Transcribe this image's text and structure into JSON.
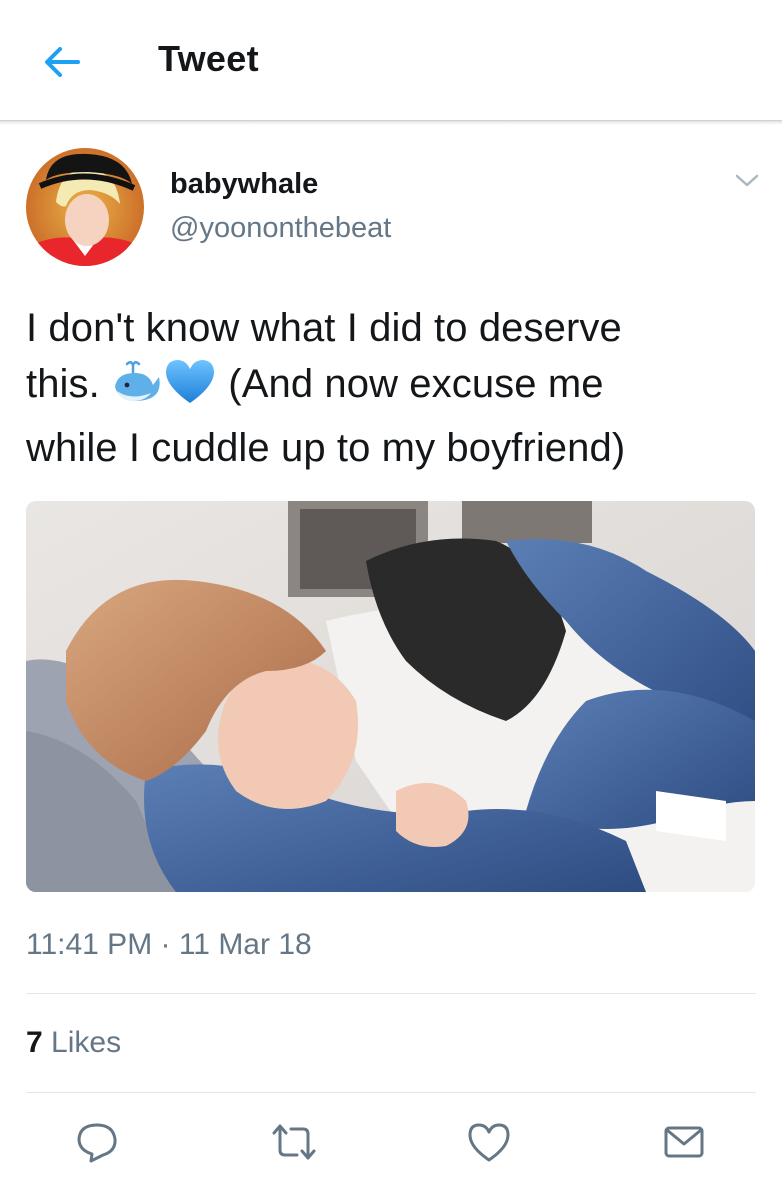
{
  "header": {
    "title": "Tweet",
    "back_icon": "arrow-left-icon",
    "accent_color": "#1da1f2"
  },
  "tweet": {
    "author": {
      "display_name": "babywhale",
      "handle": "@yoononthebeat"
    },
    "text_line1": "I don't know what I did to deserve",
    "text_line2_start": "this.",
    "text_line2_end": " (And now excuse me",
    "text_line3": "while I cuddle up to my boyfriend)",
    "emojis": [
      "spouting-whale-emoji",
      "blue-heart-emoji"
    ],
    "timestamp": "11:41 PM · 11 Mar 18",
    "likes_count": "7",
    "likes_label": "Likes"
  },
  "actions": [
    {
      "icon": "reply-icon"
    },
    {
      "icon": "retweet-icon"
    },
    {
      "icon": "like-icon"
    },
    {
      "icon": "direct-message-icon"
    }
  ],
  "colors": {
    "text": "#14171a",
    "secondary_text": "#657786",
    "divider": "#e1e8ed",
    "action_icons": "#657786"
  }
}
